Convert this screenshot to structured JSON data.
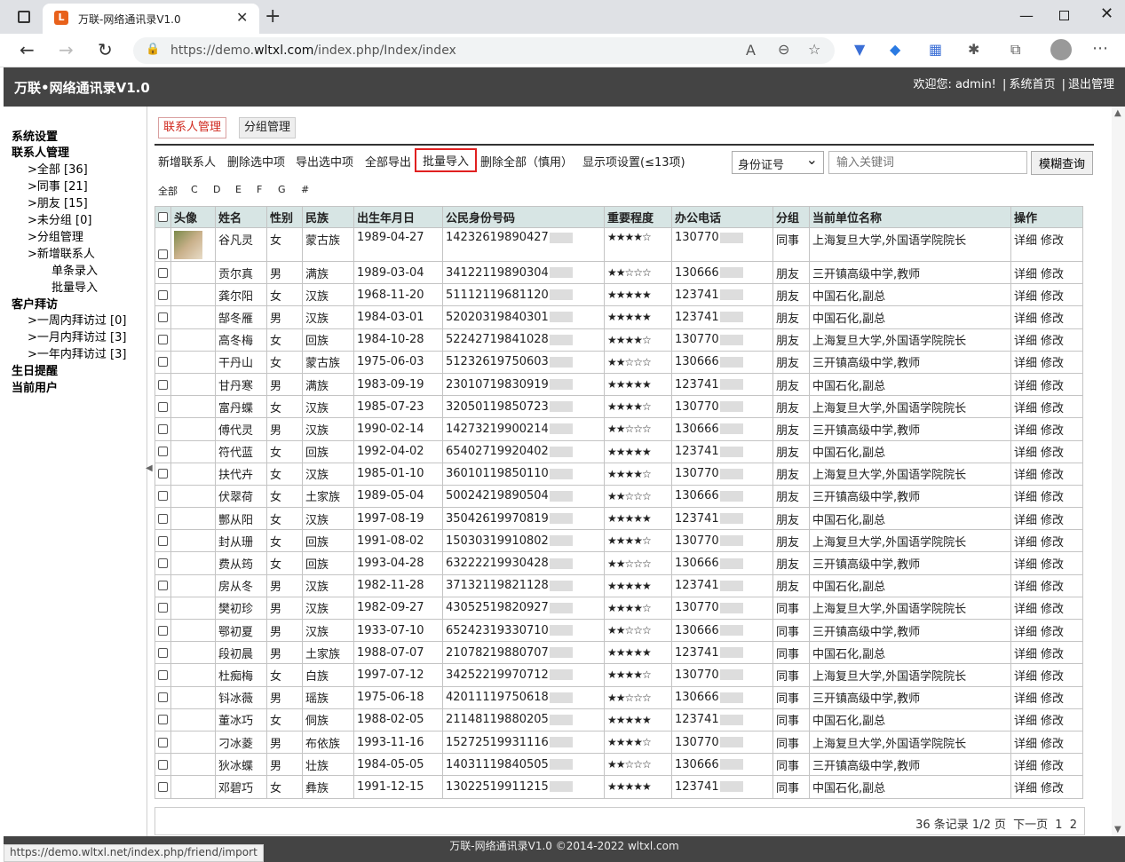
{
  "browser": {
    "tab_title": "万联-网络通讯录V1.0",
    "url_prefix": "https://demo.",
    "url_domain": "wltxl.com",
    "url_path": "/index.php/Index/index"
  },
  "header": {
    "title": "万联•网络通讯录V1.0",
    "welcome": "欢迎您: admin!",
    "home_link": "系统首页",
    "logout_link": "退出管理"
  },
  "sidebar": {
    "system": "系统设置",
    "contacts": "联系人管理",
    "all": ">全部 [36]",
    "colleague": ">同事 [21]",
    "friend": ">朋友 [15]",
    "ungrouped": ">未分组 [0]",
    "group_mgmt": ">分组管理",
    "add_contact": ">新增联系人",
    "single_add": "单条录入",
    "batch_import": "批量导入",
    "visit": "客户拜访",
    "week_visit": ">一周内拜访过 [0]",
    "month_visit": ">一月内拜访过 [3]",
    "year_visit": ">一年内拜访过 [3]",
    "birthday": "生日提醒",
    "current_user": "当前用户"
  },
  "tabs": {
    "contacts": "联系人管理",
    "groups": "分组管理"
  },
  "toolbar": {
    "add": "新增联系人",
    "delete_selected": "删除选中项",
    "export_selected": "导出选中项",
    "export_all": "全部导出",
    "batch_import": "批量导入",
    "delete_all": "删除全部（慎用）",
    "display_settings": "显示项设置(≤13项)",
    "search_field": "身份证号",
    "keyword_placeholder": "输入关键词",
    "search_button": "模糊查询"
  },
  "letters": [
    "全部",
    "C",
    "D",
    "E",
    "F",
    "G",
    "#"
  ],
  "table": {
    "headers": [
      "头像",
      "姓名",
      "性别",
      "民族",
      "出生年月日",
      "公民身份号码",
      "重要程度",
      "办公电话",
      "分组",
      "当前单位名称",
      "操作"
    ],
    "rows": [
      [
        "谷凡灵",
        "女",
        "蒙古族",
        "1989-04-27",
        "14232619890427",
        "★★★★☆",
        "130770",
        "同事",
        "上海复旦大学,外国语学院院长"
      ],
      [
        "贡尔真",
        "男",
        "满族",
        "1989-03-04",
        "34122119890304",
        "★★☆☆☆",
        "130666",
        "朋友",
        "三开镇高级中学,教师"
      ],
      [
        "龚尔阳",
        "女",
        "汉族",
        "1968-11-20",
        "51112119681120",
        "★★★★★",
        "123741",
        "朋友",
        "中国石化,副总"
      ],
      [
        "郜冬雁",
        "男",
        "汉族",
        "1984-03-01",
        "52020319840301",
        "★★★★★",
        "123741",
        "朋友",
        "中国石化,副总"
      ],
      [
        "高冬梅",
        "女",
        "回族",
        "1984-10-28",
        "52242719841028",
        "★★★★☆",
        "130770",
        "朋友",
        "上海复旦大学,外国语学院院长"
      ],
      [
        "干丹山",
        "女",
        "蒙古族",
        "1975-06-03",
        "51232619750603",
        "★★☆☆☆",
        "130666",
        "朋友",
        "三开镇高级中学,教师"
      ],
      [
        "甘丹寒",
        "男",
        "满族",
        "1983-09-19",
        "23010719830919",
        "★★★★★",
        "123741",
        "朋友",
        "中国石化,副总"
      ],
      [
        "富丹蝶",
        "女",
        "汉族",
        "1985-07-23",
        "32050119850723",
        "★★★★☆",
        "130770",
        "朋友",
        "上海复旦大学,外国语学院院长"
      ],
      [
        "傅代灵",
        "男",
        "汉族",
        "1990-02-14",
        "14273219900214",
        "★★☆☆☆",
        "130666",
        "朋友",
        "三开镇高级中学,教师"
      ],
      [
        "符代蓝",
        "女",
        "回族",
        "1992-04-02",
        "65402719920402",
        "★★★★★",
        "123741",
        "朋友",
        "中国石化,副总"
      ],
      [
        "扶代卉",
        "女",
        "汉族",
        "1985-01-10",
        "36010119850110",
        "★★★★☆",
        "130770",
        "朋友",
        "上海复旦大学,外国语学院院长"
      ],
      [
        "伏翠荷",
        "女",
        "土家族",
        "1989-05-04",
        "50024219890504",
        "★★☆☆☆",
        "130666",
        "朋友",
        "三开镇高级中学,教师"
      ],
      [
        "酆从阳",
        "女",
        "汉族",
        "1997-08-19",
        "35042619970819",
        "★★★★★",
        "123741",
        "朋友",
        "中国石化,副总"
      ],
      [
        "封从珊",
        "女",
        "回族",
        "1991-08-02",
        "15030319910802",
        "★★★★☆",
        "130770",
        "朋友",
        "上海复旦大学,外国语学院院长"
      ],
      [
        "费从筠",
        "女",
        "回族",
        "1993-04-28",
        "63222219930428",
        "★★☆☆☆",
        "130666",
        "朋友",
        "三开镇高级中学,教师"
      ],
      [
        "房从冬",
        "男",
        "汉族",
        "1982-11-28",
        "37132119821128",
        "★★★★★",
        "123741",
        "朋友",
        "中国石化,副总"
      ],
      [
        "樊初珍",
        "男",
        "汉族",
        "1982-09-27",
        "43052519820927",
        "★★★★☆",
        "130770",
        "同事",
        "上海复旦大学,外国语学院院长"
      ],
      [
        "鄂初夏",
        "男",
        "汉族",
        "1933-07-10",
        "65242319330710",
        "★★☆☆☆",
        "130666",
        "同事",
        "三开镇高级中学,教师"
      ],
      [
        "段初晨",
        "男",
        "土家族",
        "1988-07-07",
        "21078219880707",
        "★★★★★",
        "123741",
        "同事",
        "中国石化,副总"
      ],
      [
        "杜痴梅",
        "女",
        "白族",
        "1997-07-12",
        "34252219970712",
        "★★★★☆",
        "130770",
        "同事",
        "上海复旦大学,外国语学院院长"
      ],
      [
        "钭冰薇",
        "男",
        "瑶族",
        "1975-06-18",
        "42011119750618",
        "★★☆☆☆",
        "130666",
        "同事",
        "三开镇高级中学,教师"
      ],
      [
        "董冰巧",
        "女",
        "侗族",
        "1988-02-05",
        "21148119880205",
        "★★★★★",
        "123741",
        "同事",
        "中国石化,副总"
      ],
      [
        "刁冰菱",
        "男",
        "布依族",
        "1993-11-16",
        "15272519931116",
        "★★★★☆",
        "130770",
        "同事",
        "上海复旦大学,外国语学院院长"
      ],
      [
        "狄冰蝶",
        "男",
        "壮族",
        "1984-05-05",
        "14031119840505",
        "★★☆☆☆",
        "130666",
        "同事",
        "三开镇高级中学,教师"
      ],
      [
        "邓碧巧",
        "女",
        "彝族",
        "1991-12-15",
        "13022519911215",
        "★★★★★",
        "123741",
        "同事",
        "中国石化,副总"
      ]
    ],
    "action_detail": "详细",
    "action_edit": "修改"
  },
  "pager": {
    "summary": "36 条记录 1/2 页",
    "next": "下一页",
    "page1": "1",
    "page2": "2"
  },
  "footer": {
    "copyright": "万联-网络通讯录V1.0 ©2014-2022 wltxl.com",
    "status_url": "https://demo.wltxl.net/index.php/friend/import"
  },
  "colors": {
    "header_bg": "#444444",
    "table_head_bg": "#d7e5e4",
    "highlight": "#e02020",
    "active_tab": "#d0281e"
  }
}
